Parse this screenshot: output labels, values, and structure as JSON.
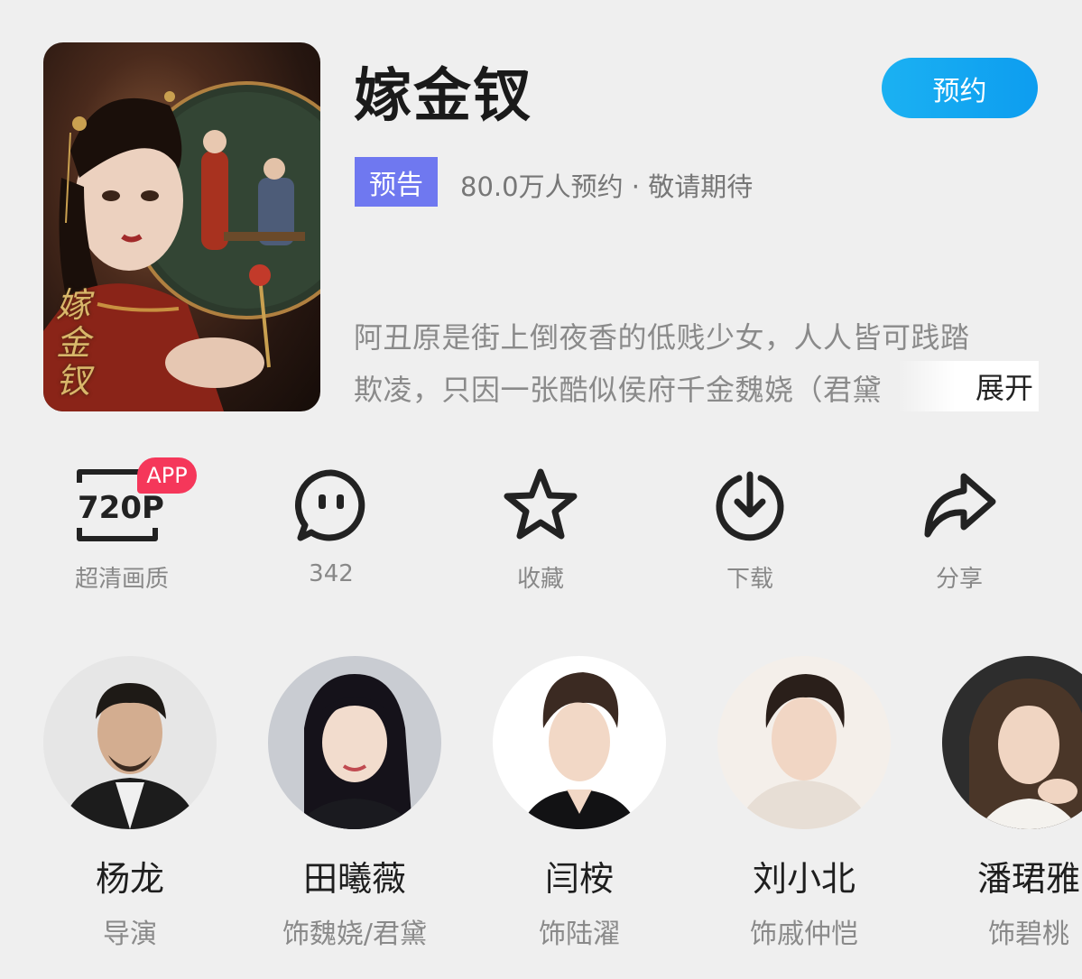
{
  "drama": {
    "title": "嫁金钗",
    "poster_text": "嫁金钗",
    "reserve_label": "预约",
    "tag": "预告",
    "meta": "80.0万人预约 · 敬请期待",
    "description_line1": "阿丑原是街上倒夜香的低贱少女，人人皆可践踏",
    "description_line2": "欺凌，只因一张酷似侯府千金魏娆（君黛",
    "expand_label": "展开"
  },
  "actions": [
    {
      "label": "超清画质",
      "icon": "720p-quality-icon",
      "badge": "APP",
      "badge_text": "720P"
    },
    {
      "label": "342",
      "icon": "comment-icon"
    },
    {
      "label": "收藏",
      "icon": "star-icon"
    },
    {
      "label": "下载",
      "icon": "download-icon"
    },
    {
      "label": "分享",
      "icon": "share-icon"
    }
  ],
  "cast": [
    {
      "name": "杨龙",
      "role": "导演"
    },
    {
      "name": "田曦薇",
      "role": "饰魏娆/君黛"
    },
    {
      "name": "闫桉",
      "role": "饰陆濯"
    },
    {
      "name": "刘小北",
      "role": "饰戚仲恺"
    },
    {
      "name": "潘珺雅",
      "role": "饰碧桃"
    }
  ],
  "colors": {
    "background": "#efefef",
    "reserve_button": "#0d9df0",
    "tag": "#6f78f0",
    "app_badge": "#f5375a"
  }
}
